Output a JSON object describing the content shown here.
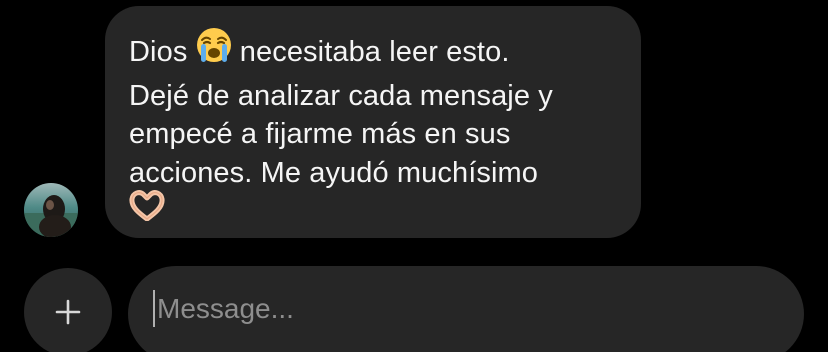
{
  "message": {
    "line1_before_emoji": "Dios",
    "emoji1": "loudly-crying-face-emoji",
    "line1_after_emoji": "necesitaba leer esto.",
    "line2": "Dejé de analizar cada mensaje y",
    "line3": "empecé a fijarme más en sus",
    "line4": "acciones. Me ayudó muchísimo",
    "emoji2": "heart-hands-emoji"
  },
  "composer": {
    "add_icon": "plus-icon",
    "placeholder": "Message..."
  },
  "colors": {
    "background": "#000000",
    "bubble": "#262626",
    "text": "#f5f5f5",
    "placeholder": "#8e8e8e"
  }
}
